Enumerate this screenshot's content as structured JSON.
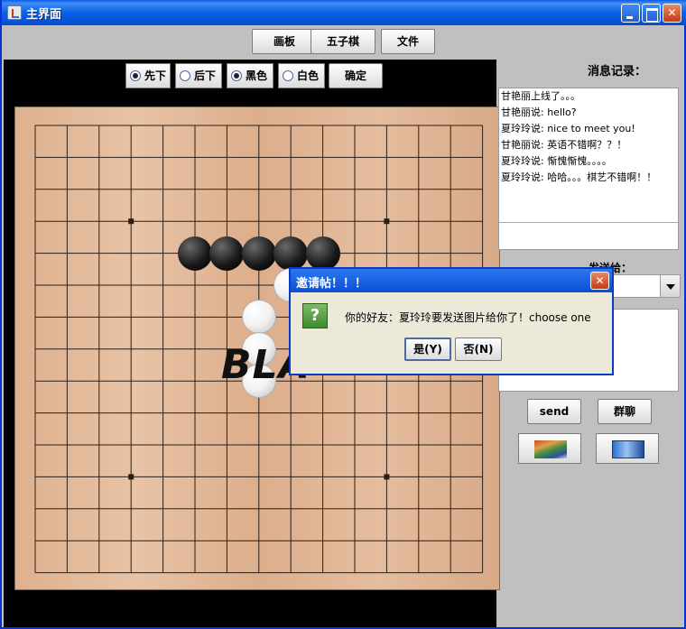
{
  "window": {
    "title": "主界面"
  },
  "nav": {
    "huaban": "画板",
    "wuziqi": "五子棋",
    "wenjian": "文件"
  },
  "options": {
    "first": "先下",
    "second": "后下",
    "black": "黑色",
    "white": "白色",
    "confirm": "确定",
    "selected": [
      "先下",
      "黑色"
    ]
  },
  "board": {
    "size": 15,
    "star_points": [
      [
        3,
        3
      ],
      [
        3,
        11
      ],
      [
        11,
        3
      ],
      [
        11,
        11
      ]
    ],
    "black_stones": [
      [
        5,
        4
      ],
      [
        6,
        4
      ],
      [
        7,
        4
      ],
      [
        8,
        4
      ],
      [
        9,
        4
      ]
    ],
    "white_stones": [
      [
        8,
        5
      ],
      [
        7,
        6
      ],
      [
        7,
        7
      ],
      [
        7,
        8
      ]
    ],
    "overlay_text": "BLA"
  },
  "chat": {
    "log_title": "消息记录：",
    "messages": [
      "甘艳丽上线了。。。",
      "甘艳丽说: hello?",
      "夏玲玲说: nice to meet you!",
      "甘艳丽说: 英语不错啊？？！",
      "夏玲玲说: 惭愧惭愧。。。。",
      "夏玲玲说: 哈哈。。。棋艺不错啊！！"
    ],
    "send_to_label": "发送给：",
    "send_label": "send",
    "group_label": "群聊"
  },
  "dialog": {
    "title": "邀请帖！！！",
    "message": "你的好友：夏玲玲要发送图片给你了！choose one",
    "yes": "是(Y)",
    "no": "否(N)"
  }
}
